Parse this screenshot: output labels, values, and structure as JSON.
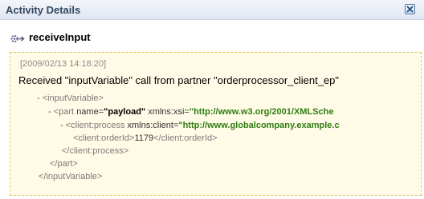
{
  "window": {
    "title": "Activity Details",
    "close_icon": "close-icon"
  },
  "activity": {
    "icon": "gear-activity-icon",
    "name": "receiveInput"
  },
  "details": {
    "timestamp": "[2009/02/13 14:18:20]",
    "message": "Received \"inputVariable\" call from partner \"orderprocessor_client_ep\"",
    "xml": {
      "toggle": "-",
      "input_variable_open": "<inputVariable>",
      "part_open_prefix": "<part",
      "part_name_attr": "name=",
      "part_name_value": "\"payload\"",
      "part_xsi_attr": "xmlns:xsi=",
      "part_xsi_value": "\"http://www.w3.org/2001/XMLSche",
      "process_open_prefix": "<client:process",
      "process_ns_attr": "xmlns:client=",
      "process_ns_value": "\"http://www.globalcompany.example.c",
      "order_id_open": "<client:orderId>",
      "order_id_value": "1179",
      "order_id_close": "</client:orderId>",
      "process_close": "</client:process>",
      "part_close": "</part>",
      "input_variable_close": "</inputVariable>"
    }
  },
  "colors": {
    "panel_background": "#fffbe6",
    "panel_border": "#e0c964",
    "namespace_value": "#2e7d12"
  }
}
